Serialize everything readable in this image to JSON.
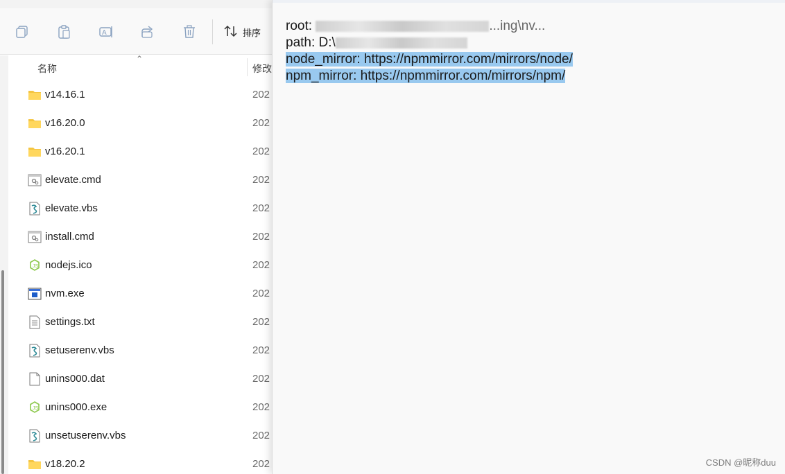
{
  "explorer": {
    "toolbar": {
      "sort_label": "排序"
    },
    "columns": {
      "name": "名称",
      "modified": "修改"
    },
    "files": [
      {
        "name": "v14.16.1",
        "date": "202",
        "icon": "folder-icon"
      },
      {
        "name": "v16.20.0",
        "date": "202",
        "icon": "folder-icon"
      },
      {
        "name": "v16.20.1",
        "date": "202",
        "icon": "folder-icon"
      },
      {
        "name": "elevate.cmd",
        "date": "202",
        "icon": "cmd-file-icon"
      },
      {
        "name": "elevate.vbs",
        "date": "202",
        "icon": "vbs-file-icon"
      },
      {
        "name": "install.cmd",
        "date": "202",
        "icon": "cmd-file-icon"
      },
      {
        "name": "nodejs.ico",
        "date": "202",
        "icon": "nodejs-icon"
      },
      {
        "name": "nvm.exe",
        "date": "202",
        "icon": "exe-file-icon"
      },
      {
        "name": "settings.txt",
        "date": "202",
        "icon": "text-file-icon"
      },
      {
        "name": "setuserenv.vbs",
        "date": "202",
        "icon": "vbs-file-icon"
      },
      {
        "name": "unins000.dat",
        "date": "202",
        "icon": "blank-file-icon"
      },
      {
        "name": "unins000.exe",
        "date": "202",
        "icon": "nodejs-icon"
      },
      {
        "name": "unsetuserenv.vbs",
        "date": "202",
        "icon": "vbs-file-icon"
      },
      {
        "name": "v18.20.2",
        "date": "202",
        "icon": "folder-icon"
      }
    ]
  },
  "notepad": {
    "lines": [
      {
        "prefix": "root: ",
        "visible_suffix": "...ing\\nv..."
      },
      {
        "prefix": "path: D:\\",
        "visible_suffix": ""
      },
      {
        "text": "node_mirror: https://npmmirror.com/mirrors/node/"
      },
      {
        "text": "npm_mirror: https://npmmirror.com/mirrors/npm/"
      }
    ],
    "selection_color": "#99c9ef"
  },
  "watermark": "CSDN @昵称duu"
}
